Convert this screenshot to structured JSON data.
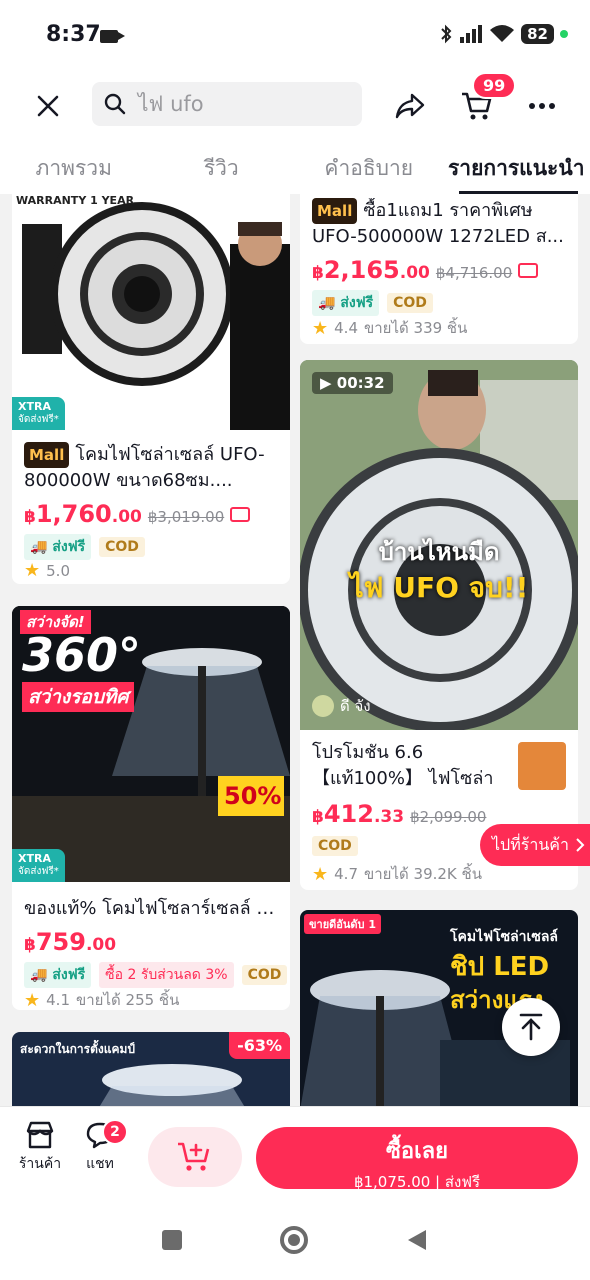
{
  "status": {
    "time": "8:37",
    "battery": "82"
  },
  "search": {
    "placeholder": "ไฟ ufo"
  },
  "cart_count": "99",
  "tabs": [
    "ภาพรวม",
    "รีวิว",
    "คำอธิบาย",
    "รายการแนะนำ"
  ],
  "products": [
    {
      "banner": "WARRANTY 1 YEAR",
      "mall": "Mall",
      "title": "โคมไฟโซล่าเซลล์ UFO-800000W ขนาด68ซม....",
      "currency": "฿",
      "price": "1,760",
      "price_dec": ".00",
      "old_price": "฿3,019.00",
      "tags": [
        "ส่งฟรี",
        "COD"
      ],
      "rating": "5.0",
      "sold": "",
      "xtra": "XTRA",
      "xtra_sub": "จัดส่งฟรี*"
    },
    {
      "mall": "Mall",
      "title": "ซื้อ1แถม1 ราคาพิเศษ UFO-500000W 1272LED ส...",
      "currency": "฿",
      "price": "2,165",
      "price_dec": ".00",
      "old_price": "฿4,716.00",
      "tags": [
        "ส่งฟรี",
        "COD"
      ],
      "rating": "4.4",
      "sold": "ขายได้ 339 ชิ้น"
    },
    {
      "video_time": "00:32",
      "overlay_line1": "บ้านไหนมืด",
      "overlay_line2": "ไฟ UFO จบ!!",
      "creator": "ดี จัง",
      "title": "โปรโมชัน 6.6 【แท้100%】 ไฟโซล่าเ...",
      "currency": "฿",
      "price": "412",
      "price_dec": ".33",
      "old_price": "฿2,099.00",
      "tags": [
        "COD"
      ],
      "rating": "4.7",
      "sold": "ขายได้ 39.2K ชิ้น"
    },
    {
      "promo_top": "สว่างจัด!",
      "promo_big": "360°",
      "promo_sub": "สว่างรอบทิศ",
      "promo_sale": "50%",
      "title": "ของแท้% โคมไฟโซลาร์เซลล์ UF...",
      "currency": "฿",
      "price": "759",
      "price_dec": ".00",
      "tags": [
        "ส่งฟรี",
        "ซื้อ 2 รับส่วนลด 3%",
        "COD"
      ],
      "rating": "4.1",
      "sold": "ขายได้ 255 ชิ้น",
      "xtra": "XTRA",
      "xtra_sub": "จัดส่งฟรี*"
    },
    {
      "badge": "-63%",
      "header": "สะดวกในการตั้งแคมป์"
    },
    {
      "line1": "โคมไฟโซล่าเซลล์",
      "line2": "ชิป LED",
      "line3": "สว่างแรง",
      "rank": "ขายดีอันดับ 1"
    }
  ],
  "goto_shop": "ไปที่ร้านค้า",
  "bottom": {
    "shop": "ร้านค้า",
    "chat": "แชท",
    "chat_badge": "2",
    "buy_label": "ซื้อเลย",
    "buy_sub": "฿1,075.00 | ส่งฟรี"
  },
  "colors": {
    "accent": "#fe2c55",
    "ship": "#16a085",
    "cod": "#b07b1b"
  }
}
